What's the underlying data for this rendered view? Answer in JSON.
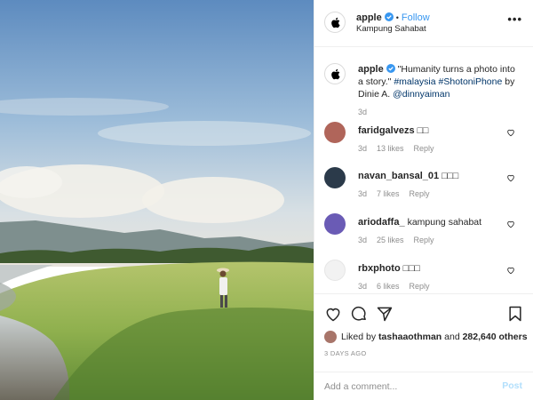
{
  "header": {
    "username": "apple",
    "separator": "•",
    "follow_label": "Follow",
    "location": "Kampung Sahabat",
    "more_label": "•••"
  },
  "caption": {
    "username": "apple",
    "text": "\"Humanity turns a photo into a story.\"",
    "hashtag_1": "#malaysia",
    "hashtag_2": "#ShotoniPhone",
    "by_text": "by Dinie A.",
    "mention": "@dinnyaiman",
    "time": "3d"
  },
  "comments": [
    {
      "username": "faridgalvezs",
      "text": "□□",
      "time": "3d",
      "likes": "13 likes",
      "reply": "Reply",
      "avatar_color": "#b0655a"
    },
    {
      "username": "navan_bansal_01",
      "text": "□□□",
      "time": "3d",
      "likes": "7 likes",
      "reply": "Reply",
      "avatar_color": "#2b3a4a"
    },
    {
      "username": "ariodaffa_",
      "text": "kampung sahabat",
      "time": "3d",
      "likes": "25 likes",
      "reply": "Reply",
      "avatar_color": "#6a5bb5"
    },
    {
      "username": "rbxphoto",
      "text": "□□□",
      "time": "3d",
      "likes": "6 likes",
      "reply": "Reply",
      "avatar_color": "#f2f2f2"
    }
  ],
  "actions": {
    "liked_prefix": "Liked by",
    "liked_user": "tashaaothman",
    "liked_and": "and",
    "liked_count": "282,640 others",
    "time_ago": "3 DAYS AGO"
  },
  "add_comment": {
    "placeholder": "Add a comment...",
    "post_label": "Post"
  },
  "colors": {
    "accent": "#3897f0",
    "verified": "#3897f0",
    "muted": "#8e8e8e",
    "hashtag": "#003569",
    "post_disabled": "#b2dffc"
  }
}
